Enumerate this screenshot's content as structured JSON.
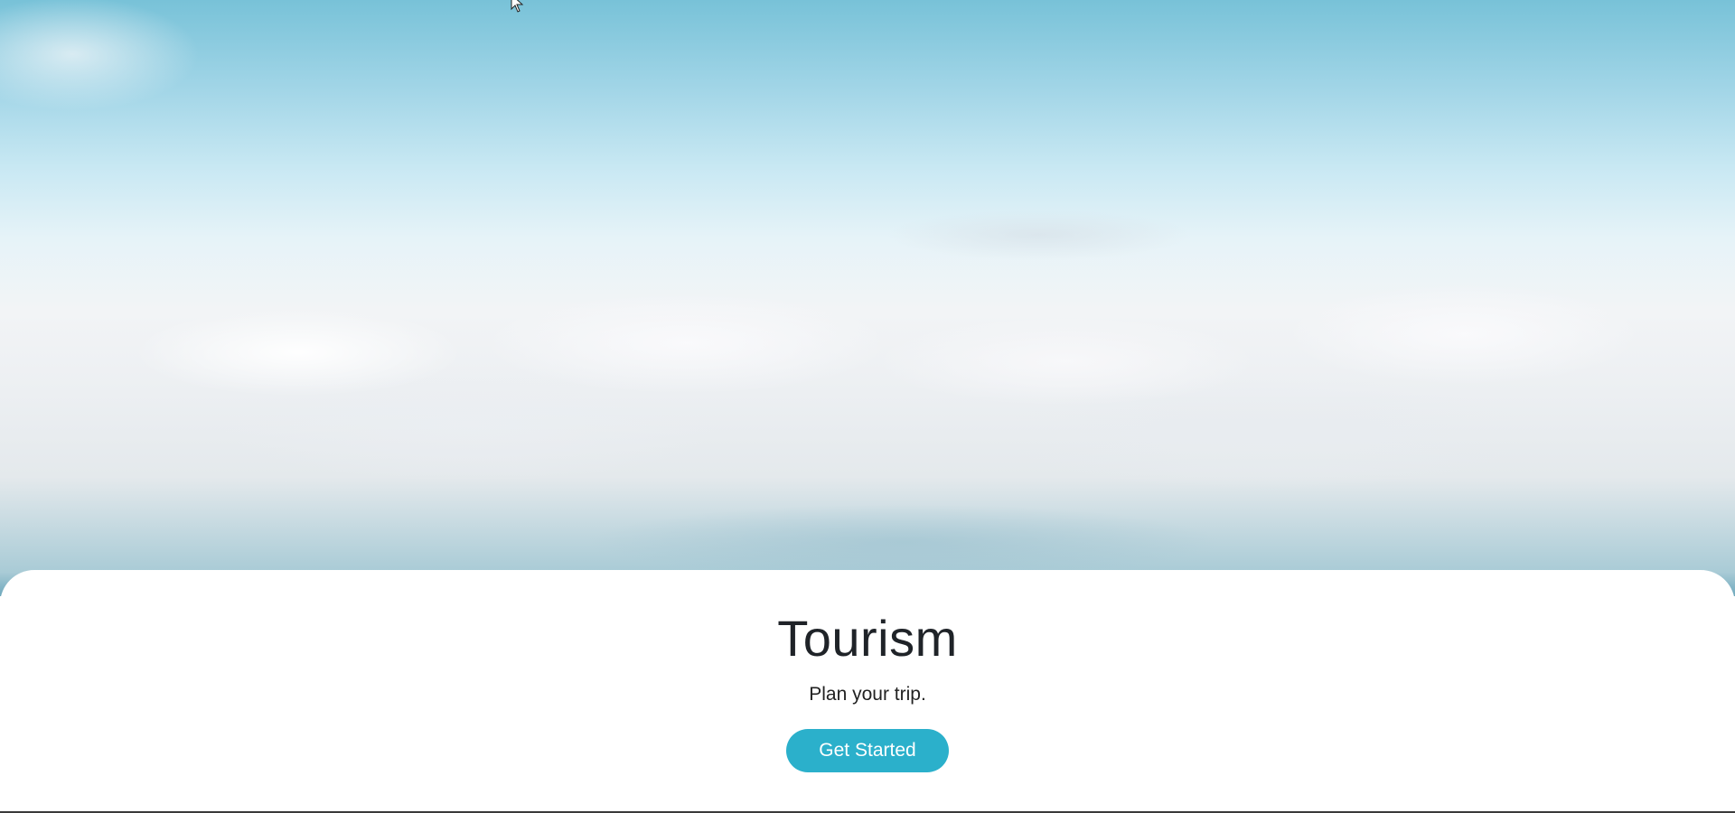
{
  "hero": {
    "image": "sky-with-clouds"
  },
  "card": {
    "title": "Tourism",
    "subtitle": "Plan your trip.",
    "cta_label": "Get Started"
  },
  "colors": {
    "accent": "#2bb0cb",
    "title_text": "#1f2328",
    "card_background": "#ffffff"
  },
  "icons": {
    "cursor": "mouse-pointer-icon"
  }
}
